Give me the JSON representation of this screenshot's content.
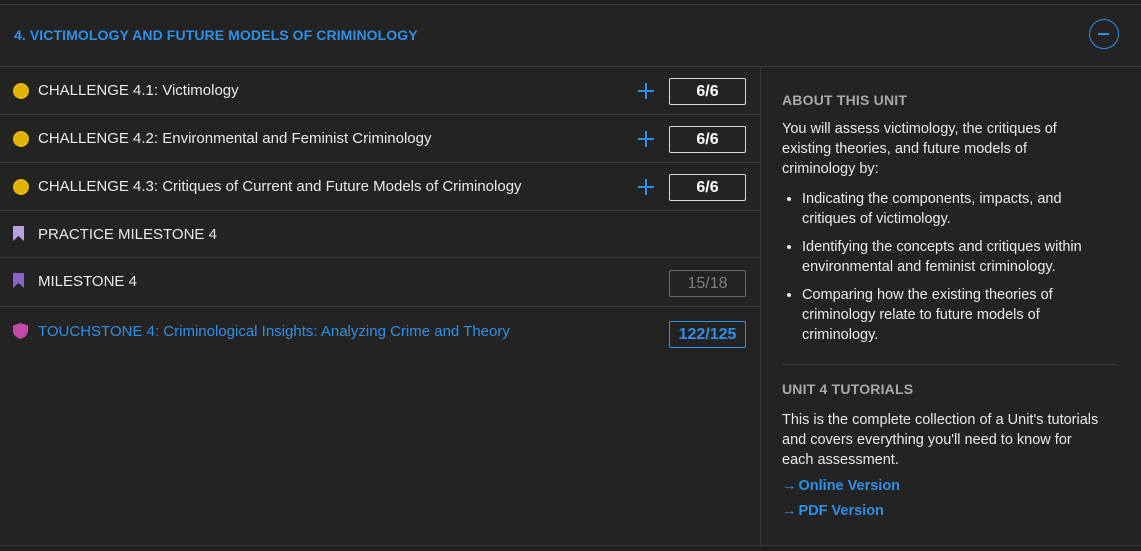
{
  "unit": {
    "title": "4. VICTIMOLOGY AND FUTURE MODELS OF CRIMINOLOGY",
    "accent_color": "#2f8fe6"
  },
  "items": [
    {
      "icon": "challenge-dot",
      "label": "CHALLENGE 4.1: Victimology",
      "score": "6/6",
      "expandable": true
    },
    {
      "icon": "challenge-dot",
      "label": "CHALLENGE 4.2: Environmental and Feminist Criminology",
      "score": "6/6",
      "expandable": true
    },
    {
      "icon": "challenge-dot",
      "label": "CHALLENGE 4.3: Critiques of Current and Future Models of Criminology",
      "score": "6/6",
      "expandable": true
    },
    {
      "icon": "practice-bookmark",
      "label": "PRACTICE MILESTONE 4",
      "score": "",
      "expandable": false
    },
    {
      "icon": "milestone-bookmark",
      "label": "MILESTONE 4",
      "score": "15/18",
      "expandable": false
    },
    {
      "icon": "touchstone-shield",
      "label": "TOUCHSTONE 4: Criminological Insights: Analyzing Crime and Theory",
      "score": "122/125",
      "expandable": false
    }
  ],
  "about": {
    "heading": "ABOUT THIS UNIT",
    "intro": "You will assess victimology, the critiques of existing theories, and future models of criminology by:",
    "bullets": [
      "Indicating the components, impacts, and critiques of victimology.",
      "Identifying the concepts and critiques within environmental and feminist criminology.",
      "Comparing how the existing theories of criminology relate to future models of criminology."
    ]
  },
  "tutorials": {
    "heading": "UNIT 4 TUTORIALS",
    "text": "This is the complete collection of a Unit's tutorials and covers everything you'll need to know for each assessment.",
    "links": [
      "Online Version",
      "PDF Version"
    ],
    "arrow": "→"
  },
  "colors": {
    "challenge_dot": "#e0b400",
    "practice_bookmark": "#b6a0dd",
    "milestone_bookmark": "#8a63c6",
    "touchstone_shield": "#c04aa6"
  }
}
